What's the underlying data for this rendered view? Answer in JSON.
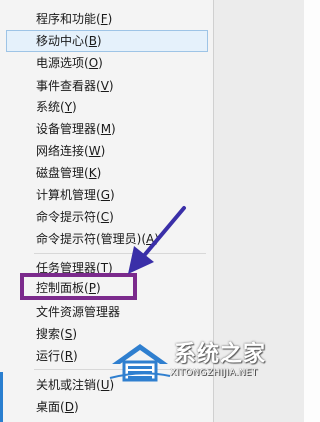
{
  "menu": {
    "items": [
      {
        "label": "程序和功能(",
        "key": "F",
        "tail": ")"
      },
      {
        "label": "移动中心(",
        "key": "B",
        "tail": ")"
      },
      {
        "label": "电源选项(",
        "key": "O",
        "tail": ")"
      },
      {
        "label": "事件查看器(",
        "key": "V",
        "tail": ")"
      },
      {
        "label": "系统(",
        "key": "Y",
        "tail": ")"
      },
      {
        "label": "设备管理器(",
        "key": "M",
        "tail": ")"
      },
      {
        "label": "网络连接(",
        "key": "W",
        "tail": ")"
      },
      {
        "label": "磁盘管理(",
        "key": "K",
        "tail": ")"
      },
      {
        "label": "计算机管理(",
        "key": "G",
        "tail": ")"
      },
      {
        "label": "命令提示符(",
        "key": "C",
        "tail": ")"
      },
      {
        "label": "命令提示符(管理员)(",
        "key": "A",
        "tail": ")"
      },
      {
        "label": "任务管理器(",
        "key": "T",
        "tail": ")"
      },
      {
        "label": "控制面板(",
        "key": "P",
        "tail": ")"
      },
      {
        "label": "文件资源管理器",
        "key": "",
        "tail": ""
      },
      {
        "label": "搜索(",
        "key": "S",
        "tail": ")"
      },
      {
        "label": "运行(",
        "key": "R",
        "tail": ")"
      },
      {
        "label": "关机或注销(",
        "key": "U",
        "tail": ")"
      },
      {
        "label": "桌面(",
        "key": "D",
        "tail": ")"
      }
    ],
    "highlighted_item": "移动中心(B)",
    "annotated_item": "控制面板(P)"
  },
  "watermark": {
    "title": "系统之家",
    "url": "XITONGZHIJIA.NET"
  },
  "colors": {
    "highlight_bg": "#e5f1fb",
    "highlight_border": "#9ec4e6",
    "annotation_box": "#7b2a8c",
    "arrow": "#3a2fa8"
  }
}
